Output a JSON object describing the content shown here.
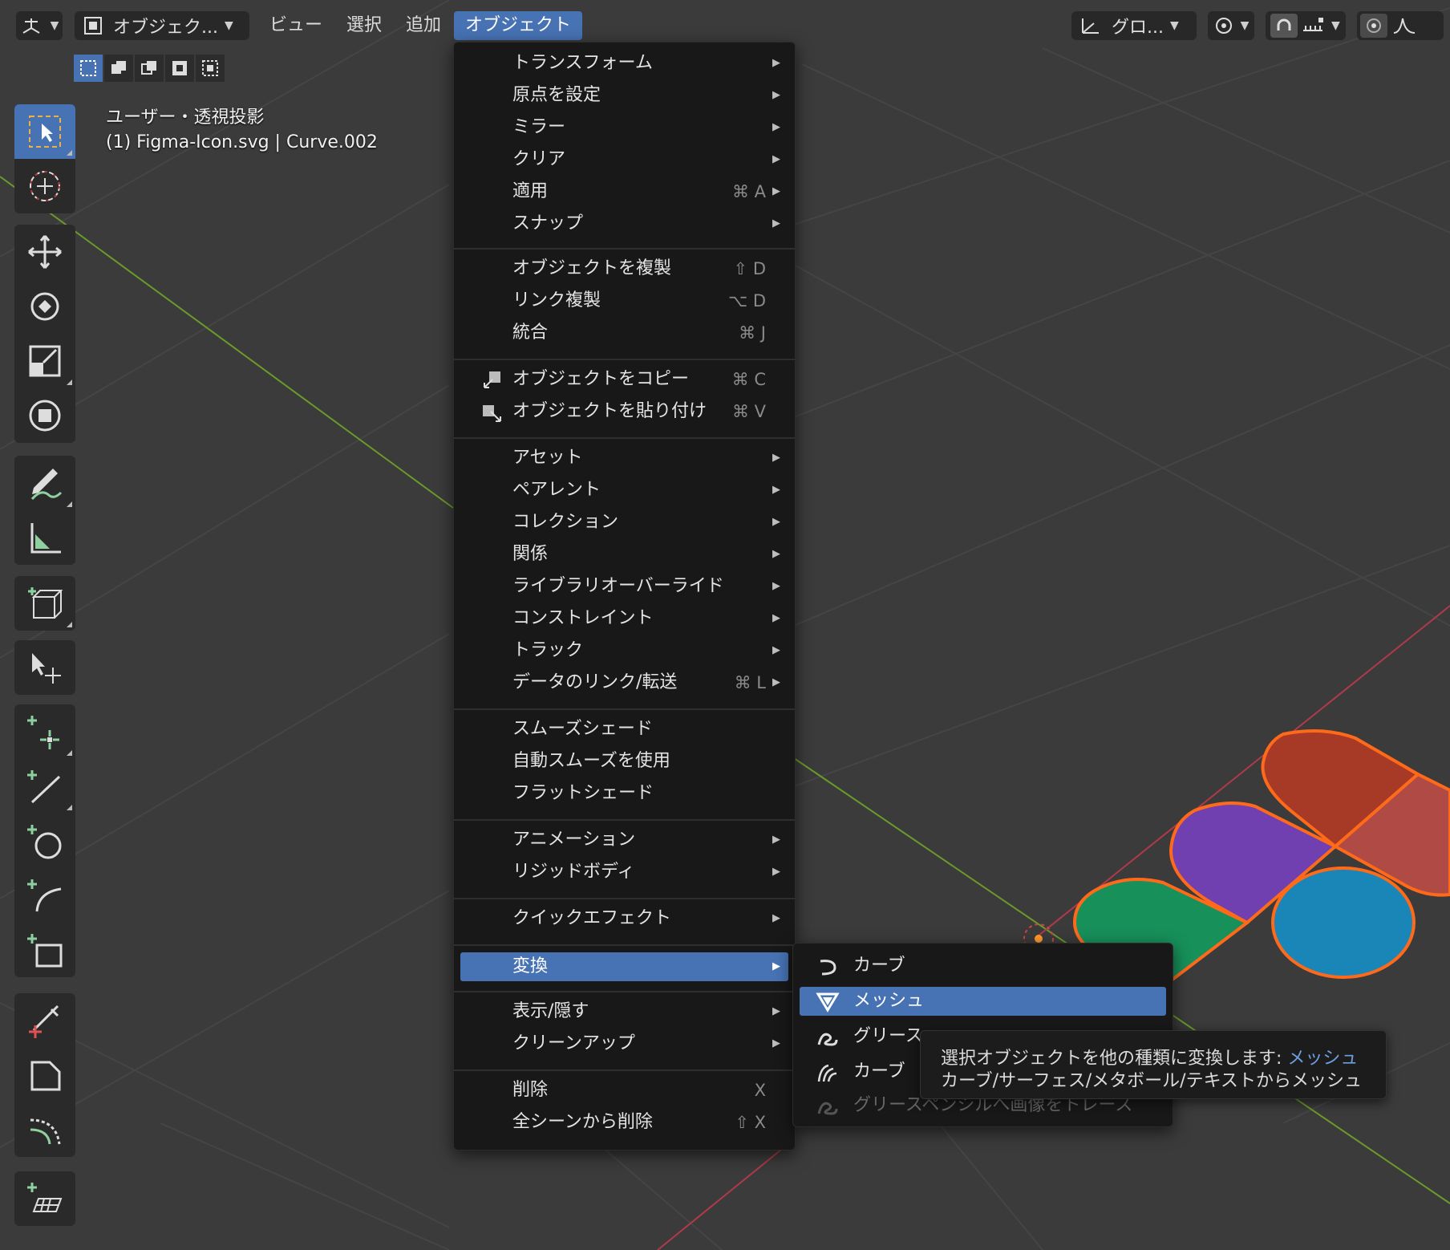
{
  "header": {
    "mode_label": "オブジェク...",
    "menus": [
      "ビュー",
      "選択",
      "追加",
      "オブジェクト"
    ],
    "orientation_label": "グロ...",
    "icons": [
      "object-mode-icon",
      "transform-orientation-icon",
      "pivot-icon",
      "snap-magnet-icon",
      "snap-increment-icon",
      "proportional-edit-icon",
      "falloff-curve-icon"
    ]
  },
  "viewport": {
    "view_name": "ユーザー・透視投影",
    "object_info": "(1) Figma-Icon.svg | Curve.002",
    "shape_colors": [
      "#a63a26",
      "#7040b0",
      "#17905a",
      "#1a86b8",
      "#b04a44"
    ],
    "outline_color": "#ff6a1a"
  },
  "toolbar": {
    "tools": [
      "select-box",
      "cursor",
      "move",
      "rotate",
      "scale",
      "transform",
      "annotate",
      "measure",
      "add-cube",
      "extrude",
      "add-vertex",
      "add-edge",
      "add-circle",
      "add-arc",
      "add-rect",
      "knife",
      "shear",
      "bend",
      "add-plane"
    ]
  },
  "object_menu": {
    "items": [
      {
        "label": "トランスフォーム",
        "shortcut": "",
        "arrow": "▶"
      },
      {
        "label": "原点を設定",
        "shortcut": "",
        "arrow": "▶"
      },
      {
        "label": "ミラー",
        "shortcut": "",
        "arrow": "▶"
      },
      {
        "label": "クリア",
        "shortcut": "",
        "arrow": "▶"
      },
      {
        "label": "適用",
        "shortcut": "⌘ A",
        "arrow": "▶"
      },
      {
        "label": "スナップ",
        "shortcut": "",
        "arrow": "▶"
      },
      {
        "label": "オブジェクトを複製",
        "shortcut": "⇧ D",
        "arrow": ""
      },
      {
        "label": "リンク複製",
        "shortcut": "⌥ D",
        "arrow": ""
      },
      {
        "label": "統合",
        "shortcut": "⌘ J",
        "arrow": ""
      },
      {
        "label": "オブジェクトをコピー",
        "shortcut": "⌘ C",
        "arrow": ""
      },
      {
        "label": "オブジェクトを貼り付け",
        "shortcut": "⌘ V",
        "arrow": ""
      },
      {
        "label": "アセット",
        "shortcut": "",
        "arrow": "▶"
      },
      {
        "label": "ペアレント",
        "shortcut": "",
        "arrow": "▶"
      },
      {
        "label": "コレクション",
        "shortcut": "",
        "arrow": "▶"
      },
      {
        "label": "関係",
        "shortcut": "",
        "arrow": "▶"
      },
      {
        "label": "ライブラリオーバーライド",
        "shortcut": "",
        "arrow": "▶"
      },
      {
        "label": "コンストレイント",
        "shortcut": "",
        "arrow": "▶"
      },
      {
        "label": "トラック",
        "shortcut": "",
        "arrow": "▶"
      },
      {
        "label": "データのリンク/転送",
        "shortcut": "⌘ L",
        "arrow": "▶"
      },
      {
        "label": "スムーズシェード",
        "shortcut": "",
        "arrow": ""
      },
      {
        "label": "自動スムーズを使用",
        "shortcut": "",
        "arrow": ""
      },
      {
        "label": "フラットシェード",
        "shortcut": "",
        "arrow": ""
      },
      {
        "label": "アニメーション",
        "shortcut": "",
        "arrow": "▶"
      },
      {
        "label": "リジッドボディ",
        "shortcut": "",
        "arrow": "▶"
      },
      {
        "label": "クイックエフェクト",
        "shortcut": "",
        "arrow": "▶"
      },
      {
        "label": "変換",
        "shortcut": "",
        "arrow": "▶"
      },
      {
        "label": "表示/隠す",
        "shortcut": "",
        "arrow": "▶"
      },
      {
        "label": "クリーンアップ",
        "shortcut": "",
        "arrow": "▶"
      },
      {
        "label": "削除",
        "shortcut": "X",
        "arrow": ""
      },
      {
        "label": "全シーンから削除",
        "shortcut": "⇧ X",
        "arrow": ""
      }
    ],
    "highlighted": "変換"
  },
  "convert_submenu": {
    "items": [
      {
        "label": "カーブ",
        "icon": "curve-icon"
      },
      {
        "label": "メッシュ",
        "icon": "mesh-icon"
      },
      {
        "label": "グリース",
        "icon": "grease-pencil-icon"
      },
      {
        "label": "カーブ",
        "icon": "curves-icon"
      },
      {
        "label": "グリースペンシルへ画像をトレース",
        "icon": "trace-image-icon"
      }
    ],
    "highlighted": "メッシュ"
  },
  "tooltip": {
    "line1": "選択オブジェクトを他の種類に変換します:",
    "line1_highlight": "メッシュ",
    "line2": "カーブ/サーフェス/メタボール/テキストからメッシュ"
  }
}
